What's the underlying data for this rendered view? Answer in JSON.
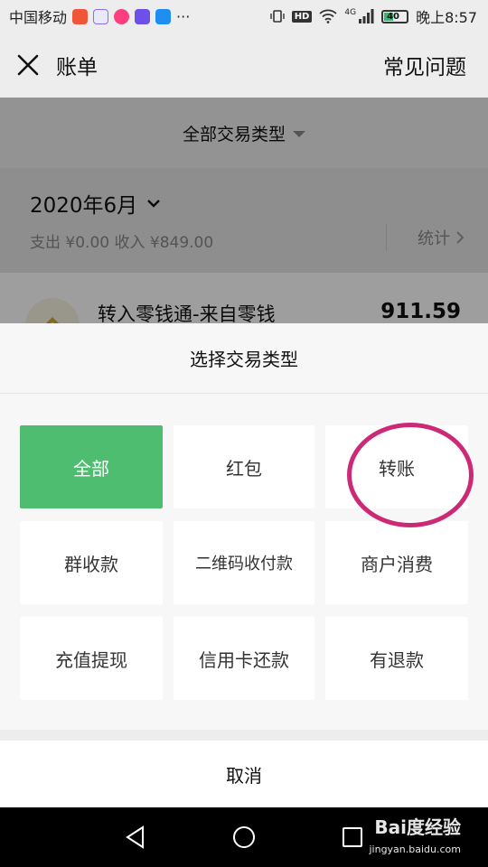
{
  "status_bar": {
    "carrier": "中国移动",
    "more": "···",
    "hd": "HD",
    "network": "4G",
    "battery": "40",
    "time": "晚上8:57"
  },
  "header": {
    "title": "账单",
    "faq": "常见问题"
  },
  "background": {
    "filter_label": "全部交易类型",
    "month": "2020年6月",
    "summary": "支出 ¥0.00 收入 ¥849.00",
    "stats_label": "统计",
    "transaction": {
      "title": "转入零钱通-来自零钱",
      "amount": "911.59"
    }
  },
  "sheet": {
    "title": "选择交易类型",
    "options": [
      "全部",
      "红包",
      "转账",
      "群收款",
      "二维码收付款",
      "商户消费",
      "充值提现",
      "信用卡还款",
      "有退款"
    ],
    "selected": "全部",
    "cancel": "取消"
  },
  "watermark": {
    "brand": "Bai度经验",
    "url": "jingyan.baidu.com"
  },
  "colors": {
    "accent": "#4fbd70",
    "highlight": "#cc2a76"
  }
}
